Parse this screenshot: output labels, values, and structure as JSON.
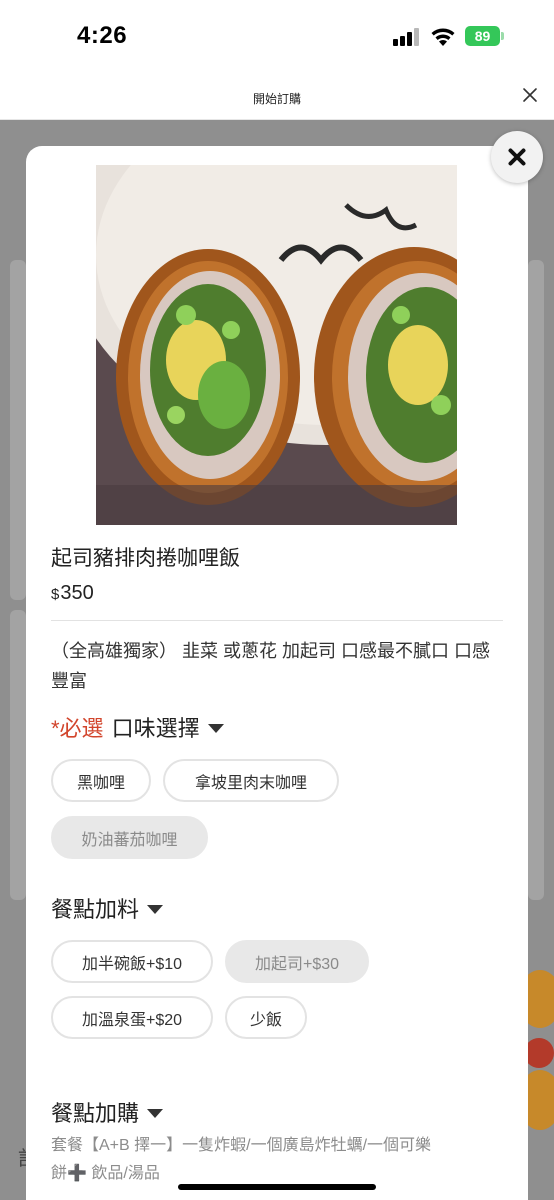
{
  "status_bar": {
    "time": "4:26",
    "battery": "89"
  },
  "sheet": {
    "title": "開始訂購"
  },
  "product": {
    "name": "起司豬排肉捲咖哩飯",
    "price_symbol": "$",
    "price": "350",
    "description": "（全高雄獨家） 韭菜 或蔥花 加起司 口感最不膩口 口感豐富"
  },
  "sections": {
    "flavor": {
      "required_label": "*必選",
      "title": "口味選擇",
      "options": [
        {
          "label": "黑咖哩",
          "disabled": false
        },
        {
          "label": "拿坡里肉末咖哩",
          "disabled": false
        },
        {
          "label": "奶油蕃茄咖哩",
          "disabled": true
        }
      ]
    },
    "toppings": {
      "title": "餐點加料",
      "options": [
        {
          "label": "加半碗飯+$10",
          "disabled": false
        },
        {
          "label": "加起司+$30",
          "disabled": true
        },
        {
          "label": "加溫泉蛋+$20",
          "disabled": false
        },
        {
          "label": "少飯",
          "disabled": false
        }
      ]
    },
    "addons": {
      "title": "餐點加購",
      "note_line1": "套餐【A+B 擇一】一隻炸蝦/一個廣島炸牡蠣/一個可樂",
      "note_line2_a": "餅",
      "note_plus": "➕",
      "note_line2_b": "飲品/湯品"
    }
  },
  "background": {
    "partial_char": "訁"
  },
  "colors": {
    "required": "#d2452c",
    "battery": "#34c759",
    "disabled_chip": "#e8e8e8"
  },
  "icons": {
    "sheet_close": "close-x-icon",
    "modal_close": "close-circle-icon",
    "section_caret": "caret-down-icon"
  }
}
